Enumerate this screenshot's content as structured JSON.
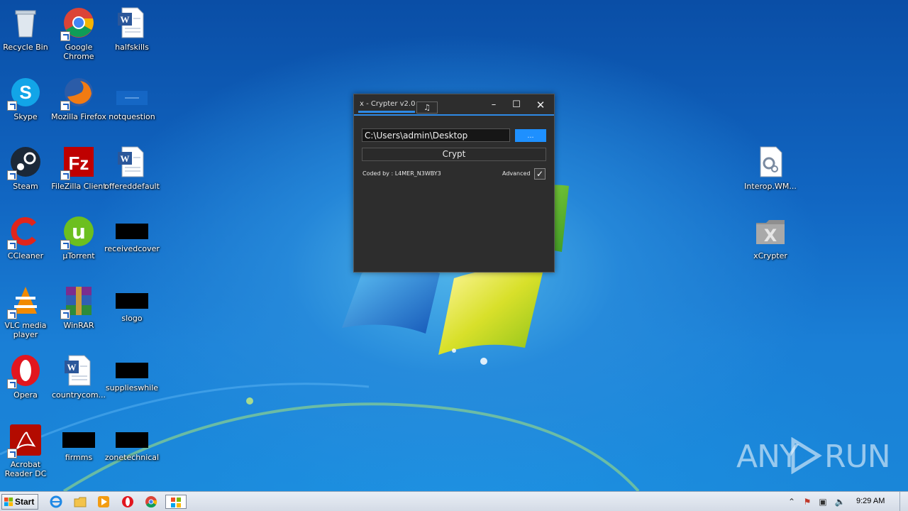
{
  "desktop": {
    "icons": [
      {
        "label": "Recycle Bin",
        "icon": "recycle-bin-icon"
      },
      {
        "label": "Google Chrome",
        "icon": "chrome-icon"
      },
      {
        "label": "halfskills",
        "icon": "word-doc-icon"
      },
      {
        "label": "Skype",
        "icon": "skype-icon"
      },
      {
        "label": "Mozilla Firefox",
        "icon": "firefox-icon"
      },
      {
        "label": "notquestion",
        "icon": "blank-file-icon"
      },
      {
        "label": "Steam",
        "icon": "steam-icon"
      },
      {
        "label": "FileZilla Client",
        "icon": "filezilla-icon"
      },
      {
        "label": "offereddefault",
        "icon": "word-doc-icon"
      },
      {
        "label": "CCleaner",
        "icon": "ccleaner-icon"
      },
      {
        "label": "µTorrent",
        "icon": "utorrent-icon"
      },
      {
        "label": "receivedcover",
        "icon": "black-thumbnail-icon"
      },
      {
        "label": "VLC media player",
        "icon": "vlc-icon"
      },
      {
        "label": "WinRAR",
        "icon": "winrar-icon"
      },
      {
        "label": "slogo",
        "icon": "black-thumbnail-icon"
      },
      {
        "label": "Opera",
        "icon": "opera-icon"
      },
      {
        "label": "countrycom...",
        "icon": "word-doc-icon"
      },
      {
        "label": "supplieswhile",
        "icon": "black-thumbnail-icon"
      },
      {
        "label": "Acrobat Reader DC",
        "icon": "acrobat-icon"
      },
      {
        "label": "firmms",
        "icon": "black-thumbnail-icon"
      },
      {
        "label": "zonetechnical",
        "icon": "black-thumbnail-icon"
      },
      {
        "label": "Interop.WM...",
        "icon": "dll-file-icon"
      },
      {
        "label": "xCrypter",
        "icon": "xcrypter-icon"
      }
    ]
  },
  "app": {
    "title": "x - Crypter v2.0",
    "music_tab": "♫",
    "minimize": "–",
    "maximize": "☐",
    "close": "✕",
    "path_value": "C:\\Users\\admin\\Desktop",
    "browse_label": "...",
    "crypt_label": "Crypt",
    "coded_by": "Coded by : L4MER_N3WBY3",
    "advanced_label": "Advanced",
    "advanced_checked": "✓",
    "accent_color": "#2e8ae6"
  },
  "watermark": {
    "left": "ANY",
    "right": "RUN"
  },
  "taskbar": {
    "start_label": "Start",
    "clock": "9:29 AM",
    "items": [
      "ie-icon",
      "explorer-icon",
      "media-player-icon",
      "opera-icon",
      "chrome-icon",
      "xcrypter-task-icon"
    ],
    "tray": [
      "show-hidden-icon",
      "action-center-icon",
      "network-icon",
      "volume-icon"
    ]
  }
}
